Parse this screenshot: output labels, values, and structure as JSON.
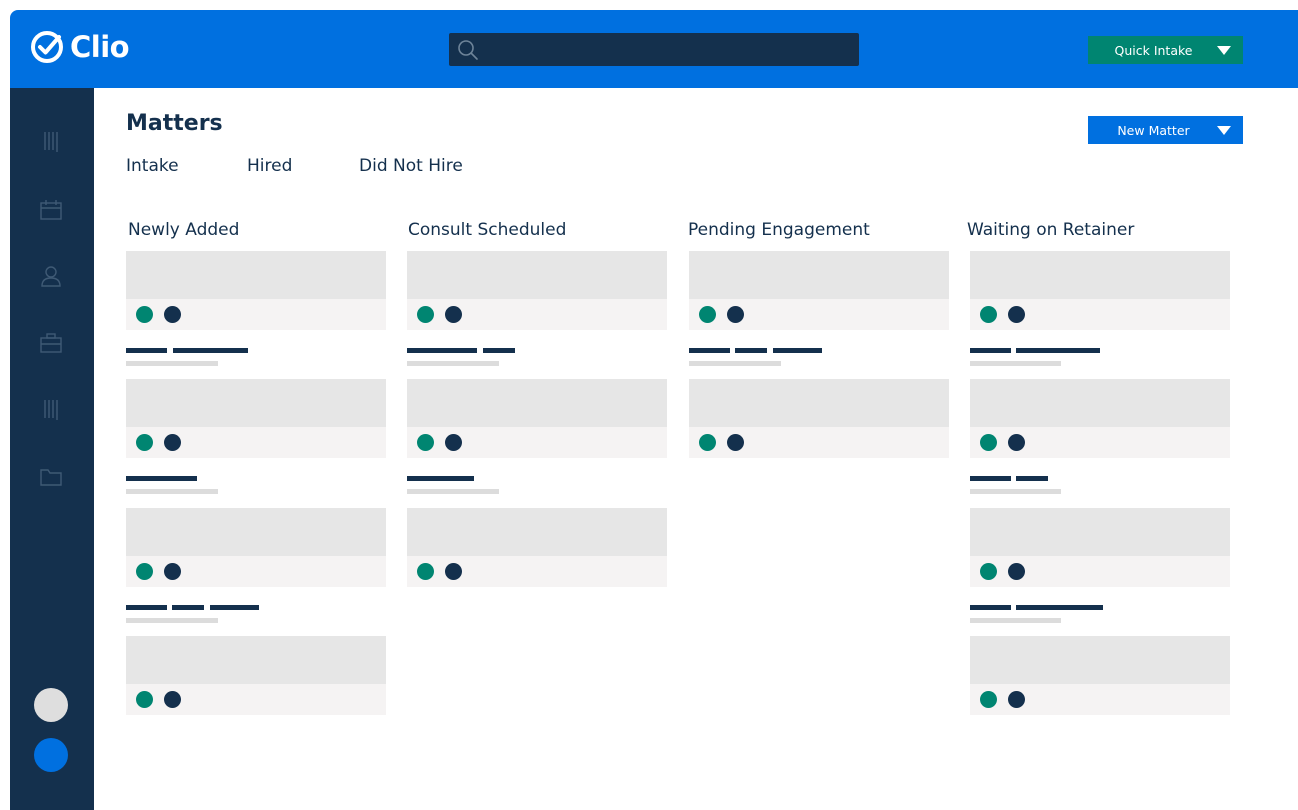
{
  "brand": {
    "name": "Clio"
  },
  "header": {
    "search_placeholder": "",
    "quick_intake_label": "Quick Intake"
  },
  "page": {
    "title": "Matters",
    "new_matter_label": "New Matter",
    "tabs": [
      "Intake",
      "Hired",
      "Did Not Hire"
    ]
  },
  "columns": [
    {
      "title": "Newly Added",
      "cards": 4
    },
    {
      "title": "Consult Scheduled",
      "cards": 3
    },
    {
      "title": "Pending Engagement",
      "cards": 2
    },
    {
      "title": "Waiting on Retainer",
      "cards": 4
    }
  ],
  "sidebar": {
    "icons": [
      "reports-icon",
      "calendar-icon",
      "contacts-icon",
      "matters-briefcase-icon",
      "billing-icon",
      "documents-folder-icon"
    ]
  },
  "colors": {
    "brand_blue": "#0070e0",
    "navy": "#14304d",
    "teal": "#008571",
    "card_gray": "#e6e6e6"
  }
}
